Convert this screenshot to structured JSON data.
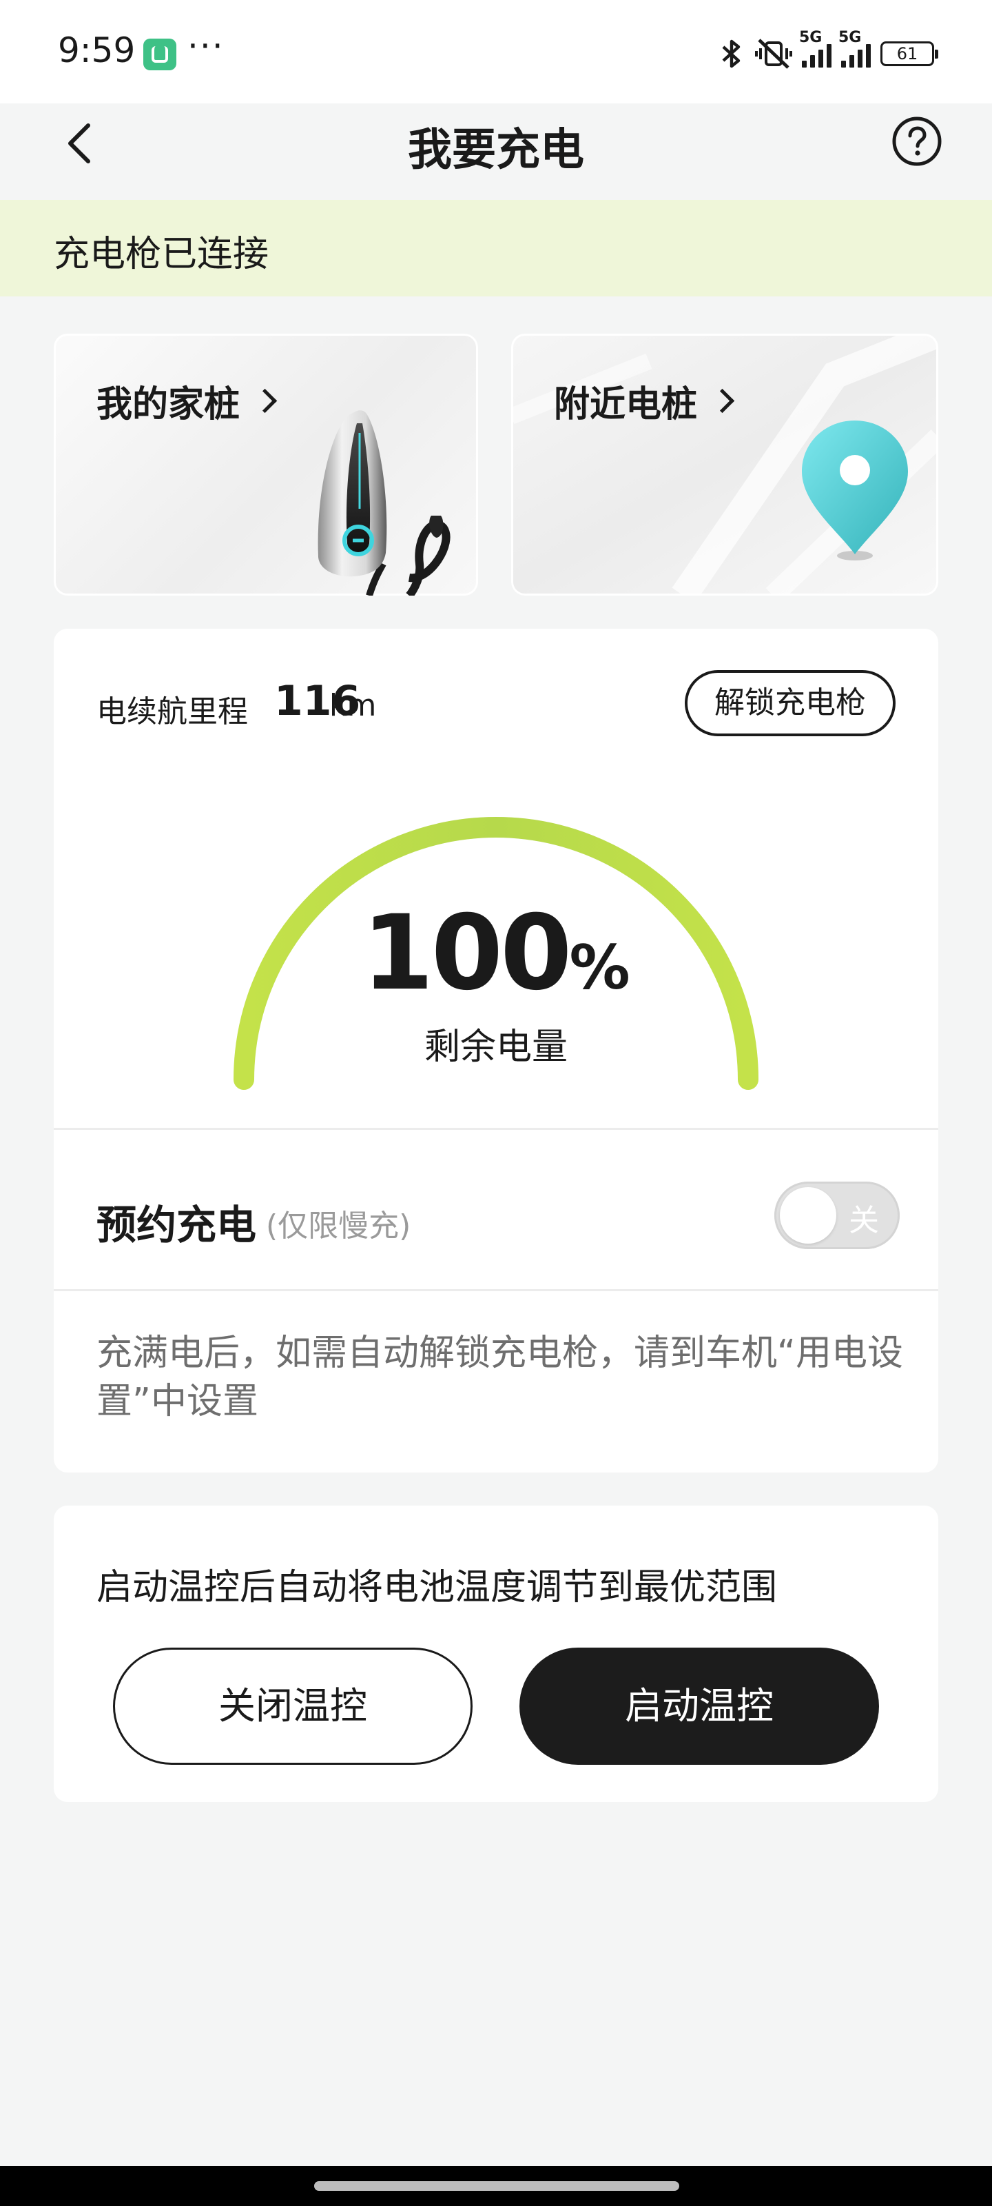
{
  "status_bar": {
    "time": "9:59",
    "app_icon": "mijia-app-icon",
    "more": "···",
    "network_1": "5G",
    "network_2": "5G",
    "battery": "61"
  },
  "header": {
    "title": "我要充电",
    "back_icon": "chevron-left-icon",
    "help_icon": "question-circle-icon"
  },
  "banner": {
    "text": "充电枪已连接",
    "color": "#eff6d9"
  },
  "cards": {
    "home_charger": {
      "label": "我的家桩"
    },
    "nearby_charger": {
      "label": "附近电桩"
    }
  },
  "battery_card": {
    "range_label": "电续航里程",
    "range_value": "116",
    "range_unit": "km",
    "unlock_button": "解锁充电枪",
    "percent_value": "100",
    "percent_sign": "%",
    "percent_label": "剩余电量",
    "charge_level": 1.0,
    "gauge_color": "#b8db45"
  },
  "schedule": {
    "title": "预约充电",
    "note": "(仅限慢充)",
    "toggle_label": "关",
    "toggle_state": "off"
  },
  "hint": {
    "text": "充满电后，如需自动解锁充电枪，请到车机“用电设置”中设置"
  },
  "temperature": {
    "text": "启动温控后自动将电池温度调节到最优范围",
    "off_button": "关闭温控",
    "on_button": "启动温控"
  }
}
